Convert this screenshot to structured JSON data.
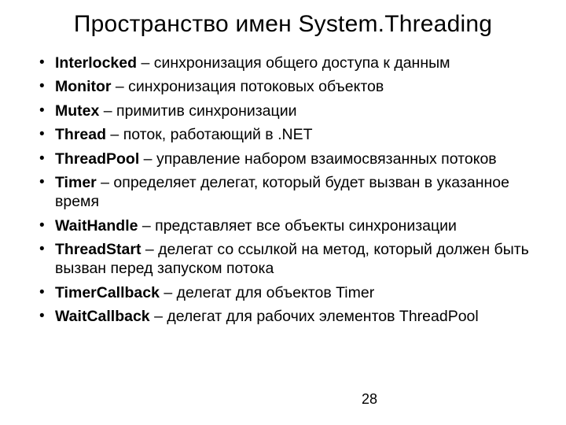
{
  "title": "Пространство имен System.Threading",
  "items": [
    {
      "term": "Interlocked",
      "desc": " – синхронизация общего доступа к данным"
    },
    {
      "term": "Monitor",
      "desc": " – синхронизация потоковых объектов"
    },
    {
      "term": "Mutex",
      "desc": " – примитив синхронизации"
    },
    {
      "term": "Thread",
      "desc": " – поток, работающий в .NET"
    },
    {
      "term": "ThreadPool",
      "desc": " – управление набором взаимосвязанных потоков"
    },
    {
      "term": "Timer",
      "desc": " – определяет делегат, который будет вызван в указанное время"
    },
    {
      "term": "WaitHandle",
      "desc": " – представляет все объекты синхронизации"
    },
    {
      "term": "ThreadStart",
      "desc": " – делегат со ссылкой на метод, который должен быть вызван перед запуском потока"
    },
    {
      "term": "TimerCallback",
      "desc": " – делегат для объектов Timer"
    },
    {
      "term": "WaitCallback",
      "desc": " – делегат для рабочих элементов ThreadPool"
    }
  ],
  "page_number": "28"
}
